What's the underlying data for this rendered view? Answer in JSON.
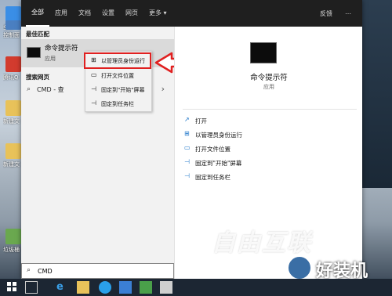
{
  "desktop": {
    "icons": [
      {
        "label": "全新",
        "color": "#3a8ee6"
      },
      {
        "label": "控制面",
        "color": "#4a7fc1"
      },
      {
        "label": "腾讯Q",
        "color": "#d23b2e"
      },
      {
        "label": "新建文 4)",
        "color": "#e8c25a"
      },
      {
        "label": "新建文 5)",
        "color": "#e8c25a"
      },
      {
        "label": "垃圾桶",
        "color": "#6aa84f"
      }
    ]
  },
  "topbar": {
    "tabs": [
      "全部",
      "应用",
      "文档",
      "设置",
      "网页",
      "更多 ▾"
    ],
    "feedback": "反馈",
    "more_icon": "⋯"
  },
  "left": {
    "best_match_heading": "最佳匹配",
    "best_match": {
      "title": "命令提示符",
      "subtitle": "应用"
    },
    "web_heading": "搜索网页",
    "web_item": {
      "label": "CMD - 查"
    }
  },
  "context_menu": {
    "items": [
      {
        "icon": "⊞",
        "label": "以管理员身份运行"
      },
      {
        "icon": "▭",
        "label": "打开文件位置"
      },
      {
        "icon": "⊣",
        "label": "固定到\"开始\"屏幕"
      },
      {
        "icon": "⊣",
        "label": "固定到任务栏"
      }
    ]
  },
  "right": {
    "title": "命令提示符",
    "subtitle": "应用",
    "actions": [
      {
        "icon": "↗",
        "label": "打开"
      },
      {
        "icon": "⊞",
        "label": "以管理员身份运行"
      },
      {
        "icon": "▭",
        "label": "打开文件位置"
      },
      {
        "icon": "⊣",
        "label": "固定到\"开始\"屏幕"
      },
      {
        "icon": "⊣",
        "label": "固定到任务栏"
      }
    ]
  },
  "search": {
    "value": "CMD"
  },
  "watermark": {
    "text": "自由互联",
    "site": "好装机"
  },
  "colors": {
    "accent": "#1a73c8",
    "highlight": "#e02020",
    "topbar": "#1f1f1f"
  }
}
